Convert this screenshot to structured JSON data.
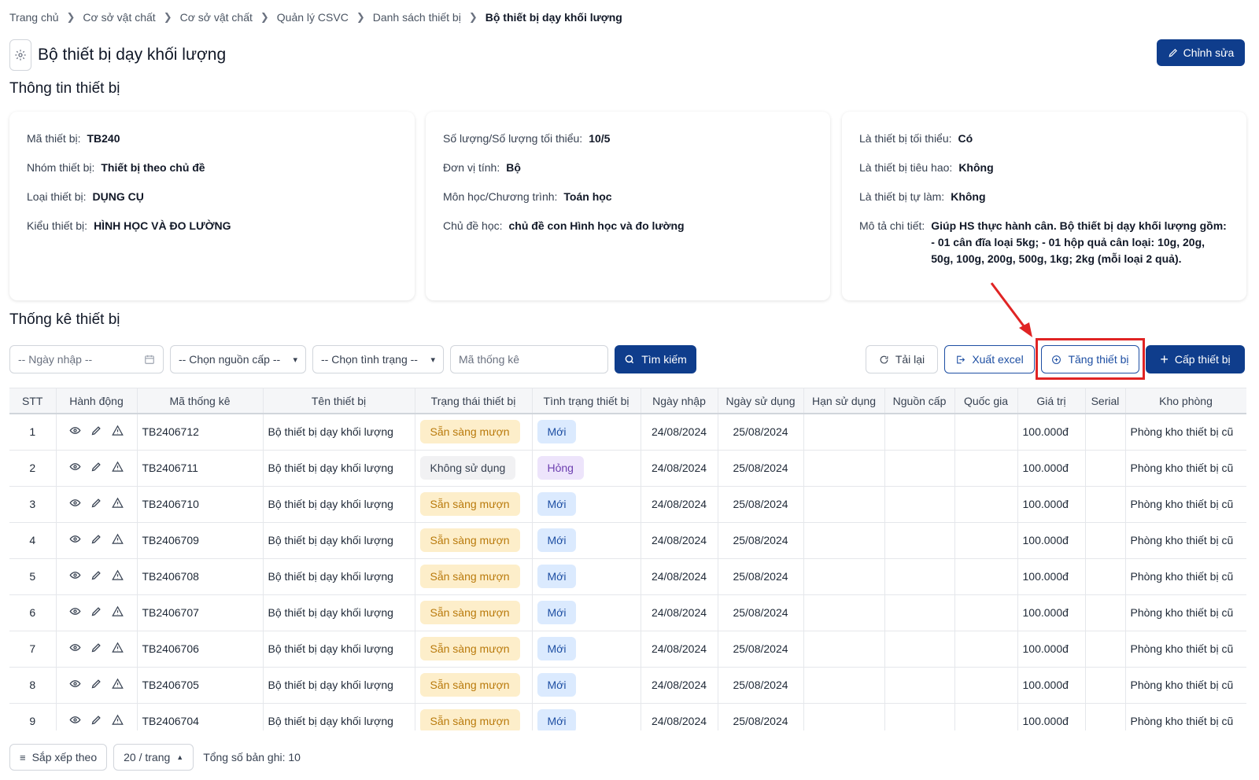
{
  "breadcrumb": [
    "Trang chủ",
    "Cơ sở vật chất",
    "Cơ sở vật chất",
    "Quản lý CSVC",
    "Danh sách thiết bị",
    "Bộ thiết bị dạy khối lượng"
  ],
  "page_title": "Bộ thiết bị dạy khối lượng",
  "edit_label": "Chỉnh sửa",
  "info_title": "Thông tin thiết bị",
  "info": {
    "col1": [
      {
        "label": "Mã thiết bị:",
        "value": "TB240"
      },
      {
        "label": "Nhóm thiết bị:",
        "value": "Thiết bị theo chủ đề"
      },
      {
        "label": "Loại thiết bị:",
        "value": "DỤNG CỤ"
      },
      {
        "label": "Kiểu thiết bị:",
        "value": "HÌNH HỌC VÀ ĐO LƯỜNG"
      }
    ],
    "col2": [
      {
        "label": "Số lượng/Số lượng tối thiểu:",
        "value": "10/5"
      },
      {
        "label": "Đơn vị tính:",
        "value": "Bộ"
      },
      {
        "label": "Môn học/Chương trình:",
        "value": "Toán học"
      },
      {
        "label": "Chủ đề học:",
        "value": "chủ đề con Hình học và đo lường"
      }
    ],
    "col3": [
      {
        "label": "Là thiết bị tối thiểu:",
        "value": "Có"
      },
      {
        "label": "Là thiết bị tiêu hao:",
        "value": "Không"
      },
      {
        "label": "Là thiết bị tự làm:",
        "value": "Không"
      },
      {
        "label": "Mô tả chi tiết:",
        "value": "Giúp HS thực hành cân. Bộ thiết bị dạy khối lượng gồm: - 01 cân đĩa loại 5kg; - 01 hộp quả cân loại: 10g, 20g, 50g, 100g, 200g, 500g, 1kg; 2kg (mỗi loại 2 quả)."
      }
    ]
  },
  "stats_title": "Thống kê thiết bị",
  "filters": {
    "date_placeholder": "-- Ngày nhập --",
    "source_select": "-- Chọn nguồn cấp --",
    "status_select": "-- Chọn tình trạng --",
    "code_placeholder": "Mã thống kê",
    "search_label": "Tìm kiếm"
  },
  "actions": {
    "reload": "Tải lại",
    "export": "Xuất excel",
    "increase": "Tăng thiết bị",
    "allocate": "Cấp thiết bị"
  },
  "table": {
    "headers": [
      "STT",
      "Hành động",
      "Mã thống kê",
      "Tên thiết bị",
      "Trạng thái thiết bị",
      "Tình trạng thiết bị",
      "Ngày nhập",
      "Ngày sử dụng",
      "Hạn sử dụng",
      "Nguồn cấp",
      "Quốc gia",
      "Giá trị",
      "Serial",
      "Kho phòng"
    ],
    "rows": [
      {
        "stt": "1",
        "code": "TB2406712",
        "name": "Bộ thiết bị dạy khối lượng",
        "state": "Sẵn sàng mượn",
        "state_kind": "ready",
        "cond": "Mới",
        "cond_kind": "new",
        "import": "24/08/2024",
        "use": "25/08/2024",
        "exp": "",
        "source": "",
        "country": "",
        "value": "100.000đ",
        "serial": "",
        "room": "Phòng kho thiết bị cũ"
      },
      {
        "stt": "2",
        "code": "TB2406711",
        "name": "Bộ thiết bị dạy khối lượng",
        "state": "Không sử dụng",
        "state_kind": "unused",
        "cond": "Hỏng",
        "cond_kind": "broken",
        "import": "24/08/2024",
        "use": "25/08/2024",
        "exp": "",
        "source": "",
        "country": "",
        "value": "100.000đ",
        "serial": "",
        "room": "Phòng kho thiết bị cũ"
      },
      {
        "stt": "3",
        "code": "TB2406710",
        "name": "Bộ thiết bị dạy khối lượng",
        "state": "Sẵn sàng mượn",
        "state_kind": "ready",
        "cond": "Mới",
        "cond_kind": "new",
        "import": "24/08/2024",
        "use": "25/08/2024",
        "exp": "",
        "source": "",
        "country": "",
        "value": "100.000đ",
        "serial": "",
        "room": "Phòng kho thiết bị cũ"
      },
      {
        "stt": "4",
        "code": "TB2406709",
        "name": "Bộ thiết bị dạy khối lượng",
        "state": "Sẵn sàng mượn",
        "state_kind": "ready",
        "cond": "Mới",
        "cond_kind": "new",
        "import": "24/08/2024",
        "use": "25/08/2024",
        "exp": "",
        "source": "",
        "country": "",
        "value": "100.000đ",
        "serial": "",
        "room": "Phòng kho thiết bị cũ"
      },
      {
        "stt": "5",
        "code": "TB2406708",
        "name": "Bộ thiết bị dạy khối lượng",
        "state": "Sẵn sàng mượn",
        "state_kind": "ready",
        "cond": "Mới",
        "cond_kind": "new",
        "import": "24/08/2024",
        "use": "25/08/2024",
        "exp": "",
        "source": "",
        "country": "",
        "value": "100.000đ",
        "serial": "",
        "room": "Phòng kho thiết bị cũ"
      },
      {
        "stt": "6",
        "code": "TB2406707",
        "name": "Bộ thiết bị dạy khối lượng",
        "state": "Sẵn sàng mượn",
        "state_kind": "ready",
        "cond": "Mới",
        "cond_kind": "new",
        "import": "24/08/2024",
        "use": "25/08/2024",
        "exp": "",
        "source": "",
        "country": "",
        "value": "100.000đ",
        "serial": "",
        "room": "Phòng kho thiết bị cũ"
      },
      {
        "stt": "7",
        "code": "TB2406706",
        "name": "Bộ thiết bị dạy khối lượng",
        "state": "Sẵn sàng mượn",
        "state_kind": "ready",
        "cond": "Mới",
        "cond_kind": "new",
        "import": "24/08/2024",
        "use": "25/08/2024",
        "exp": "",
        "source": "",
        "country": "",
        "value": "100.000đ",
        "serial": "",
        "room": "Phòng kho thiết bị cũ"
      },
      {
        "stt": "8",
        "code": "TB2406705",
        "name": "Bộ thiết bị dạy khối lượng",
        "state": "Sẵn sàng mượn",
        "state_kind": "ready",
        "cond": "Mới",
        "cond_kind": "new",
        "import": "24/08/2024",
        "use": "25/08/2024",
        "exp": "",
        "source": "",
        "country": "",
        "value": "100.000đ",
        "serial": "",
        "room": "Phòng kho thiết bị cũ"
      },
      {
        "stt": "9",
        "code": "TB2406704",
        "name": "Bộ thiết bị dạy khối lượng",
        "state": "Sẵn sàng mượn",
        "state_kind": "ready",
        "cond": "Mới",
        "cond_kind": "new",
        "import": "24/08/2024",
        "use": "25/08/2024",
        "exp": "",
        "source": "",
        "country": "",
        "value": "100.000đ",
        "serial": "",
        "room": "Phòng kho thiết bị cũ"
      }
    ]
  },
  "footer": {
    "sort_label": "Sắp xếp theo",
    "page_size": "20 / trang",
    "total": "Tổng số bản ghi: 10"
  },
  "colors": {
    "primary": "#0f3d8c",
    "highlight": "#e02424"
  }
}
